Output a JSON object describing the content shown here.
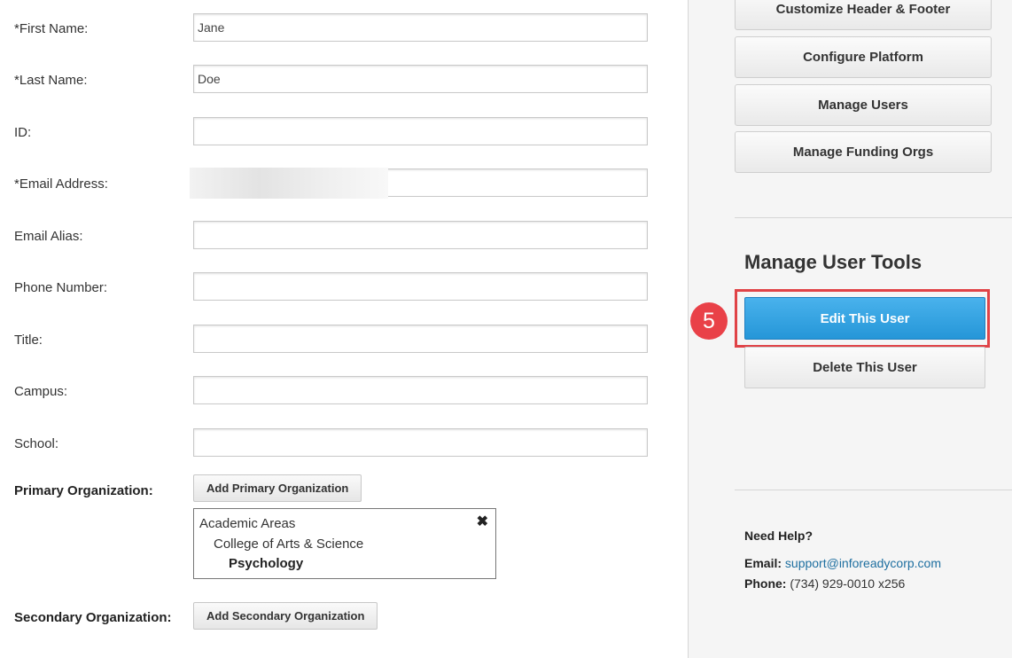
{
  "form": {
    "fields": [
      {
        "label": "*First Name:",
        "value": "Jane"
      },
      {
        "label": "*Last Name:",
        "value": "Doe"
      },
      {
        "label": "ID:",
        "value": ""
      },
      {
        "label": "*Email Address:",
        "value": ""
      },
      {
        "label": "Email Alias:",
        "value": ""
      },
      {
        "label": "Phone Number:",
        "value": ""
      },
      {
        "label": "Title:",
        "value": ""
      },
      {
        "label": "Campus:",
        "value": ""
      },
      {
        "label": "School:",
        "value": ""
      }
    ],
    "primary_org": {
      "label": "Primary Organization:",
      "button": "Add Primary Organization",
      "tree": [
        "Academic Areas",
        "College of Arts & Science",
        "Psychology"
      ],
      "remove_glyph": "✖"
    },
    "secondary_org": {
      "label": "Secondary Organization:",
      "button": "Add Secondary Organization"
    }
  },
  "sidebar": {
    "buttons": [
      "Customize Header & Footer",
      "Configure Platform",
      "Manage Users",
      "Manage Funding Orgs"
    ],
    "tools_title": "Manage User Tools",
    "edit_button": "Edit This User",
    "delete_button": "Delete This User",
    "step_badge": "5",
    "help": {
      "title": "Need Help?",
      "email_label": "Email:",
      "email": "support@inforeadycorp.com",
      "phone_label": "Phone:",
      "phone": "(734) 929-0010 x256"
    }
  },
  "colors": {
    "primary_button": "#2596d8",
    "highlight_border": "#e04347",
    "step_badge": "#e94148",
    "link": "#1e6fa0"
  }
}
